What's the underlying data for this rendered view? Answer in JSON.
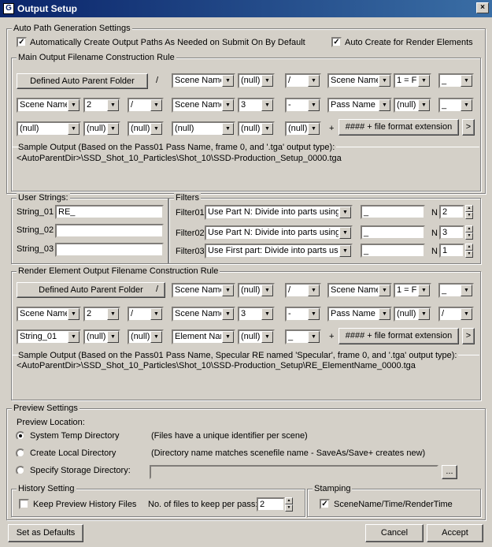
{
  "window": {
    "title": "Output Setup",
    "close": "×"
  },
  "auto": {
    "legend": "Auto Path Generation Settings",
    "chk1": "Automatically Create Output Paths As Needed on Submit On By Default",
    "chk2": "Auto Create for Render Elements"
  },
  "main": {
    "legend": "Main Output Filename Construction Rule",
    "parent_btn": "Defined Auto Parent Folder",
    "slash": "/",
    "row1": [
      "Scene Name",
      "(null)",
      "/",
      "Scene Name",
      "1 = Fi",
      "_"
    ],
    "row2": [
      "Scene Name",
      "2",
      "/",
      "Scene Name",
      "3",
      "-",
      "Pass Name",
      "(null)",
      "_"
    ],
    "row3": [
      "(null)",
      "(null)",
      "(null)",
      "(null)",
      "(null)",
      "(null)"
    ],
    "plus": "+",
    "ext_btn": "#### + file format extension",
    "more": ">",
    "sample_label": "Sample Output (Based on the Pass01 Pass Name, frame 0, and '.tga' output type):",
    "sample": "<AutoParentDir>\\SSD_Shot_10_Particles\\Shot_10\\SSD-Production_Setup_0000.tga"
  },
  "user": {
    "legend": "User Strings:",
    "s1": "String_01",
    "v1": "RE_",
    "s2": "String_02",
    "v2": "",
    "s3": "String_03",
    "v3": ""
  },
  "filters": {
    "legend": "Filters",
    "f1": "Filter01",
    "d1": "Use Part N: Divide into parts using",
    "f2": "Filter02",
    "d2": "Use Part N: Divide into parts using",
    "f3": "Filter03",
    "d3": "Use First part: Divide into parts usin",
    "t": "_",
    "n": "N",
    "n1": "2",
    "n2": "3",
    "n3": "1"
  },
  "re": {
    "legend": "Render Element Output Filename Construction Rule",
    "parent_btn": "Defined Auto Parent Folder",
    "slash": "/",
    "row1": [
      "Scene Name",
      "(null)",
      "/",
      "Scene Name",
      "1 = Fi",
      "_"
    ],
    "row2": [
      "Scene Name",
      "2",
      "/",
      "Scene Name",
      "3",
      "-",
      "Pass Name",
      "(null)",
      "/"
    ],
    "row3": [
      "String_01",
      "(null)",
      "(null)",
      "Element Nam",
      "(null)",
      "_"
    ],
    "plus": "+",
    "ext_btn": "#### + file format extension",
    "more": ">",
    "sample_label": "Sample Output (Based on the Pass01 Pass Name, Specular RE named 'Specular', frame 0, and '.tga' output type):",
    "sample": "<AutoParentDir>\\SSD_Shot_10_Particles\\Shot_10\\SSD-Production_Setup\\RE_ElementName_0000.tga"
  },
  "preview": {
    "legend": "Preview Settings",
    "loc": "Preview Location:",
    "r1": "System Temp Directory",
    "r1d": "(Files have a unique identifier per scene)",
    "r2": "Create Local Directory",
    "r2d": "(Directory name matches scenefile name - SaveAs/Save+ creates new)",
    "r3": "Specify Storage Directory:",
    "browse": "..."
  },
  "history": {
    "legend": "History Setting",
    "chk": "Keep Preview History Files",
    "files_label": "No. of files to keep per pass:",
    "files": "2"
  },
  "stamp": {
    "legend": "Stamping",
    "chk": "SceneName/Time/RenderTime"
  },
  "footer": {
    "defaults": "Set as Defaults",
    "cancel": "Cancel",
    "accept": "Accept"
  }
}
